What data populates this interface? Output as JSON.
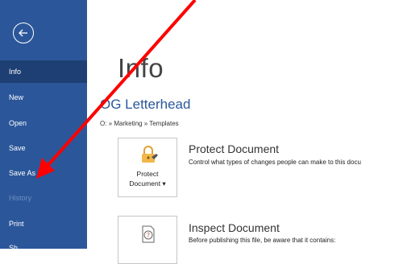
{
  "sidebar": {
    "items": [
      {
        "label": "Info"
      },
      {
        "label": "New"
      },
      {
        "label": "Open"
      },
      {
        "label": "Save"
      },
      {
        "label": "Save As"
      },
      {
        "label": "History"
      },
      {
        "label": "Print"
      },
      {
        "label": "Sh"
      }
    ]
  },
  "main": {
    "title": "Info",
    "document_title": "OG Letterhead",
    "breadcrumb": "O: » Marketing » Templates",
    "protect": {
      "button_line1": "Protect",
      "button_line2": "Document ▾",
      "heading": "Protect Document",
      "description": "Control what types of changes people can make to this docu"
    },
    "inspect": {
      "heading": "Inspect Document",
      "description": "Before publishing this file, be aware that it contains:"
    }
  },
  "colors": {
    "sidebar_bg": "#2b579a",
    "active_item_bg": "#1e3f73",
    "arrow": "#ff0000"
  }
}
